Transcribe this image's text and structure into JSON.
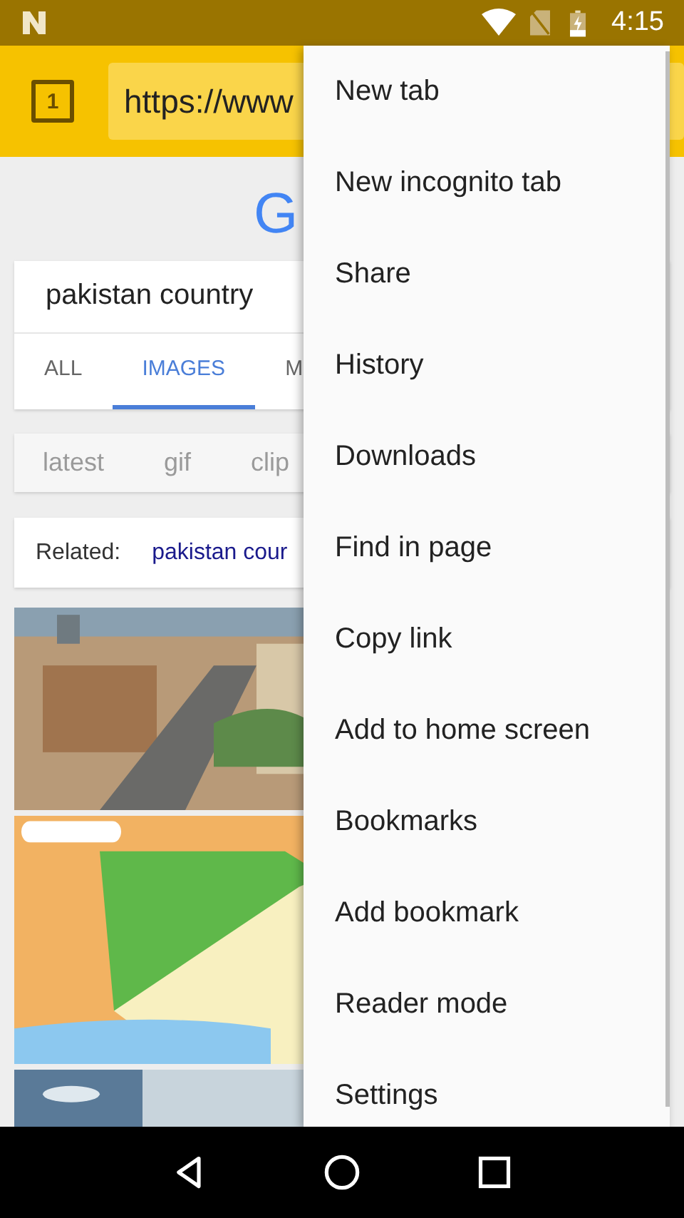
{
  "status_bar": {
    "time": "4:15"
  },
  "toolbar": {
    "tab_count": "1",
    "url": "https://www"
  },
  "page": {
    "logo": "G",
    "query": "pakistan country",
    "tabs": [
      {
        "label": "ALL",
        "selected": false
      },
      {
        "label": "IMAGES",
        "selected": true
      },
      {
        "label": "M",
        "selected": false
      }
    ],
    "chips": [
      "latest",
      "gif",
      "clip"
    ],
    "related": {
      "label": "Related:",
      "link": "pakistan cour"
    }
  },
  "menu": {
    "items": [
      "New tab",
      "New incognito tab",
      "Share",
      "History",
      "Downloads",
      "Find in page",
      "Copy link",
      "Add to home screen",
      "Bookmarks",
      "Add bookmark",
      "Reader mode",
      "Settings"
    ]
  }
}
